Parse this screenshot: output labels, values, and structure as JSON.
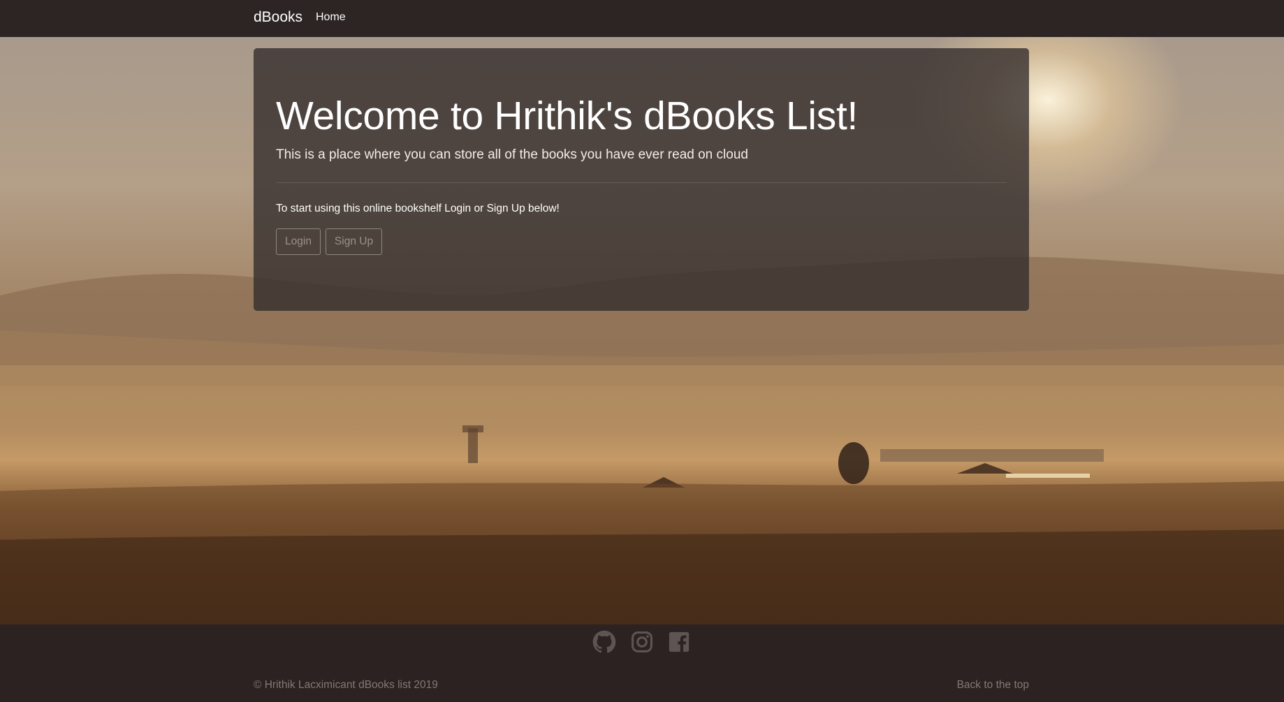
{
  "navbar": {
    "brand": "dBooks",
    "home_link": "Home"
  },
  "jumbotron": {
    "title": "Welcome to Hrithik's dBooks List!",
    "lead": "This is a place where you can store all of the books you have ever read on cloud",
    "text": "To start using this online bookshelf Login or Sign Up below!",
    "login_button": "Login",
    "signup_button": "Sign Up"
  },
  "footer": {
    "social_icons": [
      "github-icon",
      "instagram-icon",
      "facebook-icon"
    ],
    "copyright": "© Hrithik Lacximicant dBooks list 2019",
    "back_to_top": "Back to the top"
  },
  "colors": {
    "navbar_bg": "#2c2524",
    "footer_bg": "#2b2221",
    "jumbotron_bg": "rgba(50,44,44,0.78)",
    "footer_text": "#847a74"
  }
}
